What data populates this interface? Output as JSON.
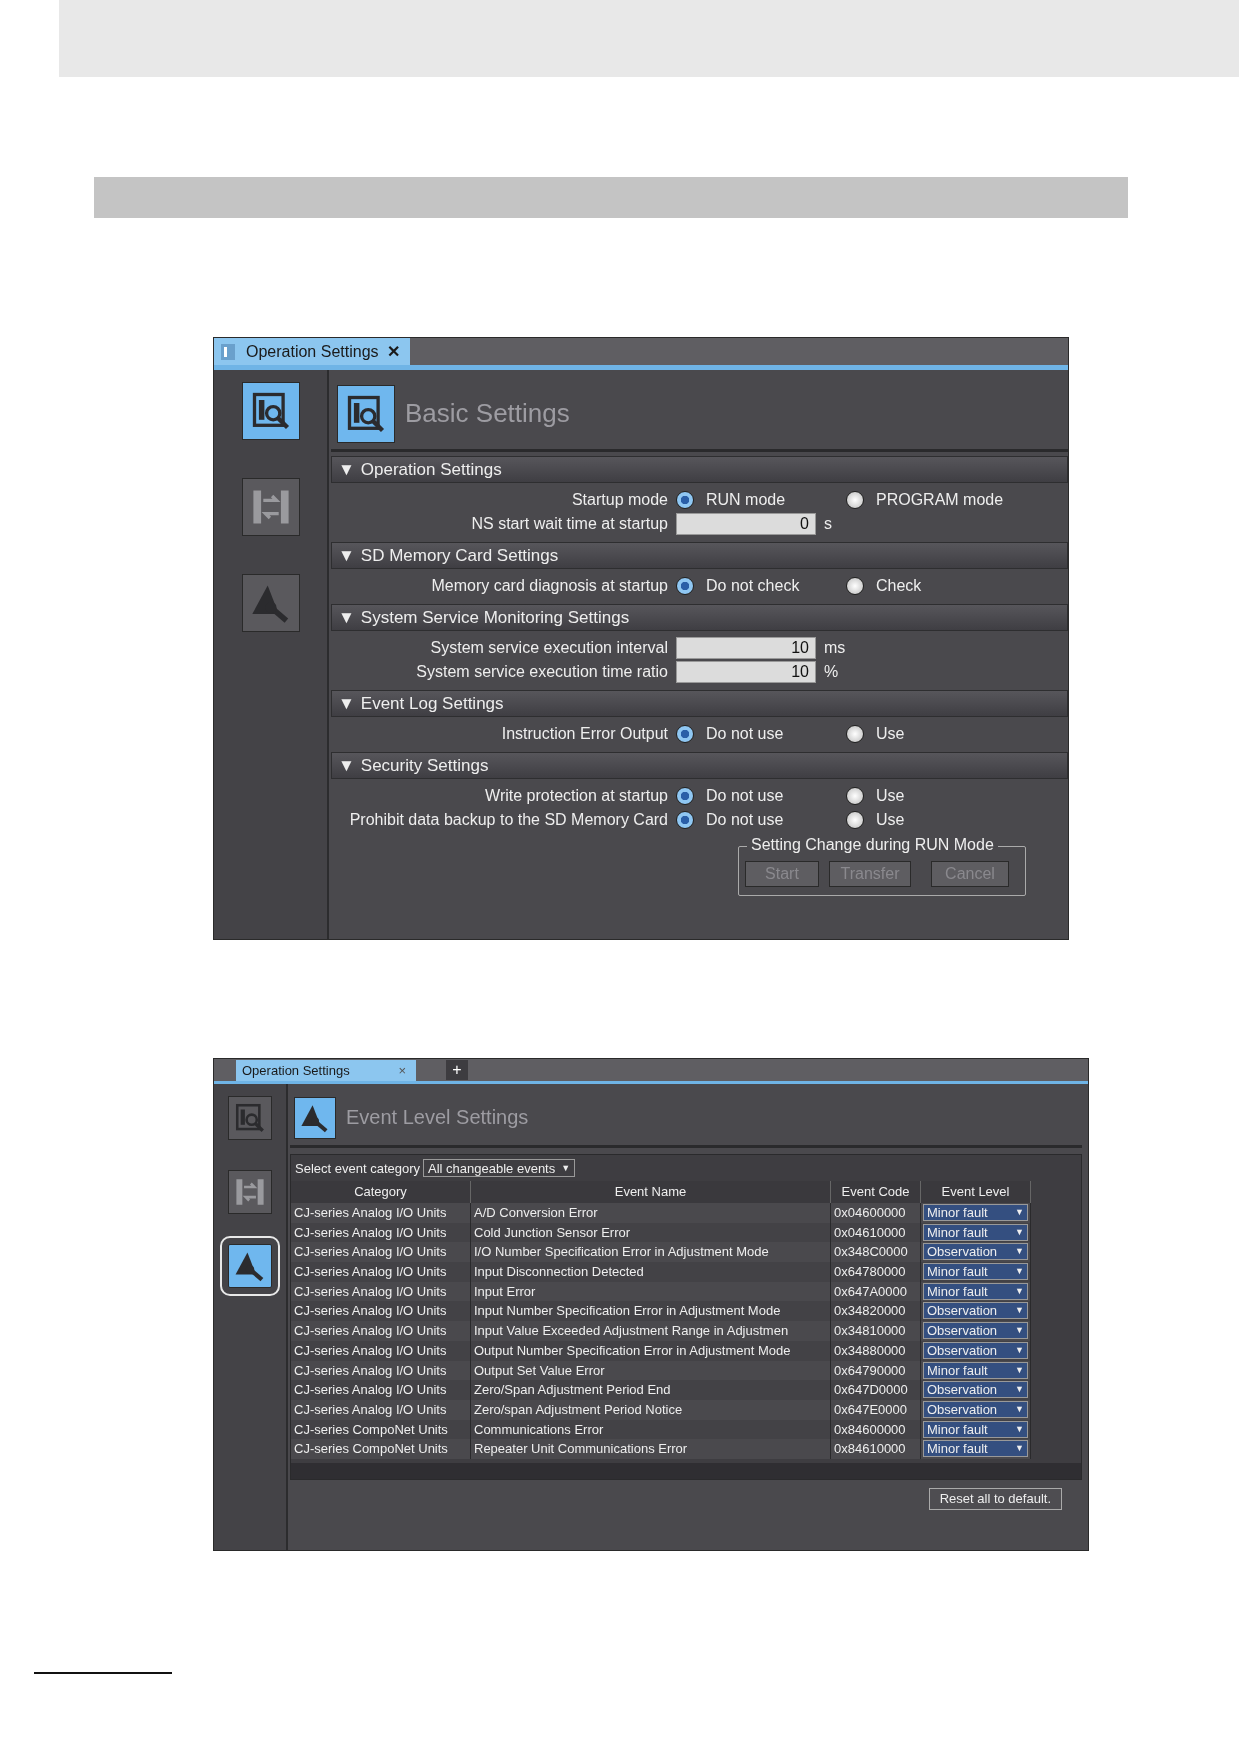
{
  "basic": {
    "tab": {
      "title": "Operation Settings",
      "close": "✕"
    },
    "sidebar": [
      {
        "kind": "settings",
        "selected": true
      },
      {
        "kind": "transfer",
        "selected": false
      },
      {
        "kind": "event",
        "selected": false
      }
    ],
    "heading": "Basic Settings",
    "sections": [
      {
        "title": "Operation Settings",
        "marker": "▼",
        "rows": [
          {
            "kind": "radio",
            "label": "Startup mode",
            "options": [
              {
                "label": "RUN mode",
                "selected": true
              },
              {
                "label": "PROGRAM mode",
                "selected": false
              }
            ]
          },
          {
            "kind": "number",
            "label": "NS start wait time at startup",
            "value": "0",
            "unit": "s"
          }
        ]
      },
      {
        "title": "SD Memory Card Settings",
        "marker": "▼",
        "rows": [
          {
            "kind": "radio",
            "label": "Memory card diagnosis at startup",
            "options": [
              {
                "label": "Do not check",
                "selected": true
              },
              {
                "label": "Check",
                "selected": false
              }
            ]
          }
        ]
      },
      {
        "title": "System Service Monitoring Settings",
        "marker": "▼",
        "rows": [
          {
            "kind": "number",
            "label": "System service execution interval",
            "value": "10",
            "unit": "ms"
          },
          {
            "kind": "number",
            "label": "System service execution time ratio",
            "value": "10",
            "unit": "%"
          }
        ]
      },
      {
        "title": "Event Log Settings",
        "marker": "▼",
        "rows": [
          {
            "kind": "radio",
            "label": "Instruction Error Output",
            "options": [
              {
                "label": "Do not use",
                "selected": true
              },
              {
                "label": "Use",
                "selected": false
              }
            ]
          }
        ]
      },
      {
        "title": "Security Settings",
        "marker": "▼",
        "rows": [
          {
            "kind": "radio",
            "label": "Write protection at startup",
            "options": [
              {
                "label": "Do not use",
                "selected": true
              },
              {
                "label": "Use",
                "selected": false
              }
            ]
          },
          {
            "kind": "radio",
            "label": "Prohibit data backup to the SD Memory Card",
            "options": [
              {
                "label": "Do not use",
                "selected": true
              },
              {
                "label": "Use",
                "selected": false
              }
            ]
          }
        ]
      }
    ],
    "run_mode_group": {
      "title": "Setting Change during RUN Mode",
      "buttons": [
        {
          "label": "Start",
          "disabled": true
        },
        {
          "label": "Transfer",
          "disabled": true
        },
        {
          "label": "Cancel",
          "disabled": true
        }
      ]
    }
  },
  "event": {
    "tab": {
      "title": "Operation Settings",
      "close": "×",
      "add": "+"
    },
    "sidebar": [
      {
        "kind": "settings",
        "selected": false
      },
      {
        "kind": "transfer",
        "selected": false
      },
      {
        "kind": "event",
        "selected": true
      }
    ],
    "heading": "Event Level Settings",
    "filter": {
      "label": "Select event category",
      "value": "All changeable events",
      "caret": "▼"
    },
    "columns": [
      "Category",
      "Event Name",
      "Event Code",
      "Event Level"
    ],
    "rows": [
      {
        "category": "CJ-series Analog I/O Units",
        "name": "A/D Conversion Error",
        "code": "0x04600000",
        "level": "Minor fault"
      },
      {
        "category": "CJ-series Analog I/O Units",
        "name": "Cold Junction Sensor Error",
        "code": "0x04610000",
        "level": "Minor fault"
      },
      {
        "category": "CJ-series Analog I/O Units",
        "name": "I/O Number Specification Error in Adjustment Mode",
        "code": "0x348C0000",
        "level": "Observation"
      },
      {
        "category": "CJ-series Analog I/O Units",
        "name": "Input Disconnection Detected",
        "code": "0x64780000",
        "level": "Minor fault"
      },
      {
        "category": "CJ-series Analog I/O Units",
        "name": "Input Error",
        "code": "0x647A0000",
        "level": "Minor fault"
      },
      {
        "category": "CJ-series Analog I/O Units",
        "name": "Input Number Specification Error in Adjustment Mode",
        "code": "0x34820000",
        "level": "Observation"
      },
      {
        "category": "CJ-series Analog I/O Units",
        "name": "Input Value Exceeded Adjustment Range in Adjustmen",
        "code": "0x34810000",
        "level": "Observation"
      },
      {
        "category": "CJ-series Analog I/O Units",
        "name": "Output Number Specification Error in Adjustment Mode",
        "code": "0x34880000",
        "level": "Observation"
      },
      {
        "category": "CJ-series Analog I/O Units",
        "name": "Output Set Value Error",
        "code": "0x64790000",
        "level": "Minor fault"
      },
      {
        "category": "CJ-series Analog I/O Units",
        "name": "Zero/Span Adjustment Period End",
        "code": "0x647D0000",
        "level": "Observation"
      },
      {
        "category": "CJ-series Analog I/O Units",
        "name": "Zero/span Adjustment Period Notice",
        "code": "0x647E0000",
        "level": "Observation"
      },
      {
        "category": "CJ-series CompoNet Units",
        "name": "Communications Error",
        "code": "0x84600000",
        "level": "Minor fault"
      },
      {
        "category": "CJ-series CompoNet Units",
        "name": "Repeater Unit Communications Error",
        "code": "0x84610000",
        "level": "Minor fault"
      }
    ],
    "level_caret": "▼",
    "reset_button": "Reset all to default."
  }
}
